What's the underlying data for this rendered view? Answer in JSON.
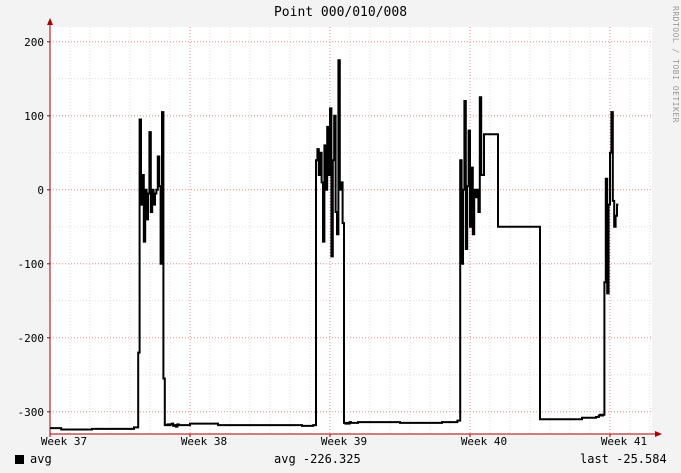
{
  "chart_data": {
    "type": "line",
    "title": "Point 000/010/008",
    "xlabel": "",
    "ylabel": "",
    "x_ticks": [
      "Week 37",
      "Week 38",
      "Week 39",
      "Week 40",
      "Week 41"
    ],
    "ylim": [
      -330,
      220
    ],
    "y_ticks": [
      200,
      100,
      0,
      -100,
      -200,
      -300
    ],
    "grid": true,
    "series": [
      {
        "name": "avg",
        "color": "#000000",
        "x": [
          0,
          0.08,
          0.3,
          0.6,
          0.63,
          0.64,
          0.65,
          0.66,
          0.67,
          0.68,
          0.69,
          0.7,
          0.71,
          0.72,
          0.73,
          0.74,
          0.75,
          0.76,
          0.77,
          0.78,
          0.79,
          0.8,
          0.81,
          0.82,
          0.83,
          0.84,
          0.85,
          0.86,
          0.87,
          0.88,
          0.89,
          0.9,
          0.91,
          0.92,
          0.93,
          1.0,
          1.2,
          1.5,
          1.8,
          1.88,
          1.9,
          1.91,
          1.92,
          1.93,
          1.94,
          1.95,
          1.96,
          1.97,
          1.98,
          1.99,
          2.0,
          2.01,
          2.02,
          2.03,
          2.04,
          2.05,
          2.06,
          2.07,
          2.08,
          2.09,
          2.1,
          2.11,
          2.12,
          2.13,
          2.14,
          2.15,
          2.2,
          2.5,
          2.8,
          2.91,
          2.93,
          2.94,
          2.95,
          2.96,
          2.97,
          2.98,
          2.99,
          3.0,
          3.01,
          3.02,
          3.03,
          3.04,
          3.05,
          3.06,
          3.07,
          3.08,
          3.1,
          3.2,
          3.5,
          3.8,
          3.9,
          3.92,
          3.93,
          3.94,
          3.95,
          3.96,
          3.97,
          3.98,
          3.99,
          4.0,
          4.01,
          4.02,
          4.03,
          4.04,
          4.05
        ],
        "values": [
          -322,
          -324,
          -323,
          -321,
          -220,
          95,
          -20,
          20,
          -70,
          0,
          -40,
          -5,
          78,
          -30,
          0,
          -20,
          -5,
          0,
          45,
          5,
          -100,
          105,
          -255,
          -318,
          -318,
          -317,
          -318,
          -317,
          -316,
          -319,
          -318,
          -320,
          -317,
          -318,
          -318,
          -316,
          -318,
          -318,
          -319,
          -318,
          40,
          55,
          20,
          50,
          10,
          -70,
          60,
          0,
          85,
          20,
          110,
          -90,
          40,
          100,
          -30,
          -60,
          175,
          0,
          10,
          -45,
          -315,
          -316,
          -315,
          -316,
          -314,
          -315,
          -314,
          -315,
          -314,
          -312,
          40,
          -100,
          0,
          120,
          -80,
          5,
          80,
          -50,
          30,
          -60,
          0,
          -10,
          0,
          -30,
          125,
          20,
          75,
          -50,
          -310,
          -308,
          -307,
          -305,
          -304,
          -305,
          -304,
          -125,
          15,
          -140,
          -20,
          50,
          105,
          -15,
          -50,
          -35,
          -20
        ]
      }
    ]
  },
  "legend": {
    "label": "avg",
    "color": "#000000"
  },
  "stats": {
    "avg": "avg -226.325",
    "last": "last -25.584"
  },
  "watermark": "RRDTOOL / TOBI OETIKER"
}
